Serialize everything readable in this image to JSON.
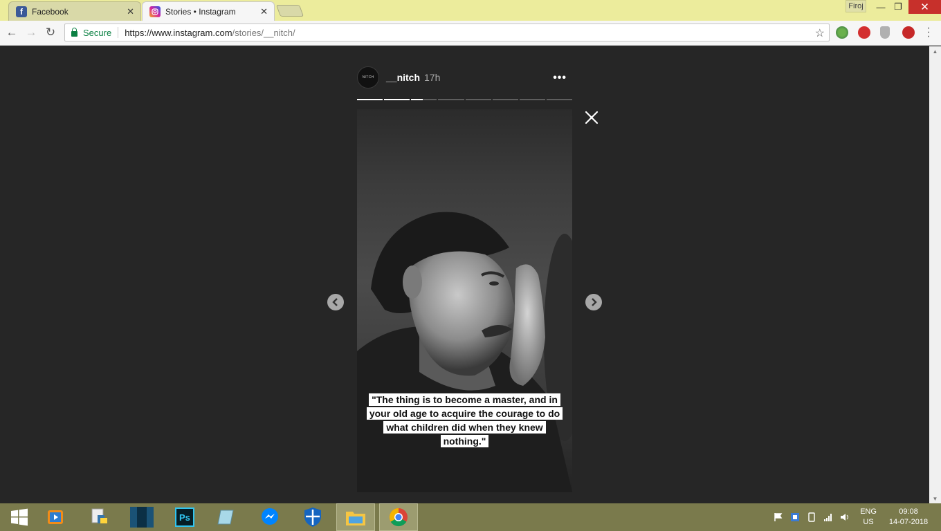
{
  "browser": {
    "tabs": [
      {
        "title": "Facebook",
        "active": false,
        "favicon": "facebook-icon"
      },
      {
        "title": "Stories • Instagram",
        "active": true,
        "favicon": "instagram-icon"
      }
    ],
    "profile_name": "Firoj",
    "address": {
      "secure_label": "Secure",
      "url_scheme_host": "https://www.instagram.com",
      "url_path": "/stories/__nitch/"
    }
  },
  "story": {
    "avatar_text": "NITCH",
    "username": "__nitch",
    "time_ago": "17h",
    "more_label": "•••",
    "progress": [
      1,
      1,
      0.45,
      0,
      0,
      0,
      0,
      0
    ],
    "quote_lines": [
      "\"The thing is to become a master, and in",
      "your old age to acquire the courage to do",
      "what children did when they knew",
      "nothing.\""
    ]
  },
  "taskbar": {
    "apps": [
      "windows-start-icon",
      "media-player-icon",
      "python-icon",
      "dark-app-icon",
      "photoshop-icon",
      "notes-app-icon",
      "messenger-icon",
      "shield-app-icon",
      "file-explorer-icon",
      "chrome-icon"
    ],
    "language": "ENG",
    "region": "US",
    "time": "09:08",
    "date": "14-07-2018"
  },
  "colors": {
    "page_bg": "#262626",
    "taskbar": "#7a7a4c",
    "tabstrip": "#ecec9c",
    "secure_green": "#0b8043"
  }
}
